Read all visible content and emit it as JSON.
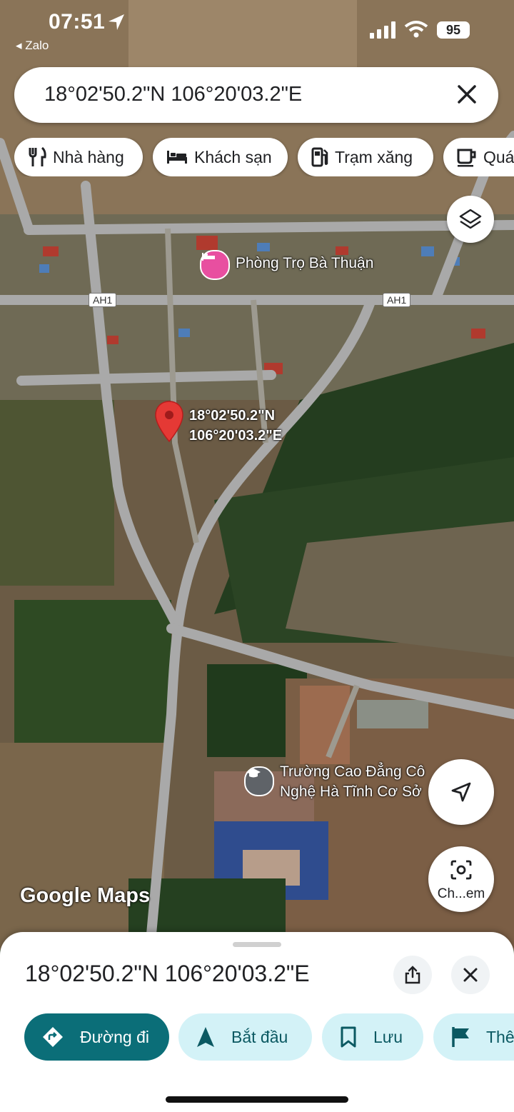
{
  "status_bar": {
    "time": "07:51",
    "back_app": "◂ Zalo",
    "battery": "95"
  },
  "search": {
    "query": "18°02'50.2\"N 106°20'03.2\"E"
  },
  "chips": [
    {
      "label": "Nhà hàng",
      "icon": "fork-knife-icon"
    },
    {
      "label": "Khách sạn",
      "icon": "bed-icon"
    },
    {
      "label": "Trạm xăng",
      "icon": "gas-pump-icon"
    },
    {
      "label": "Quá",
      "icon": "coffee-cup-icon"
    }
  ],
  "map": {
    "places": [
      {
        "name": "Phòng Trọ Bà Thuận",
        "icon": "hotel-bed-icon",
        "color": "#e84fa0"
      },
      {
        "name": "Trường Cao Đẳng Công Nghệ Hà Tĩnh Cơ Sở",
        "line1": "Trường Cao Đẳng Cô",
        "line2": "Nghệ Hà Tĩnh Cơ Sở",
        "icon": "graduation-cap-icon",
        "color": "#5f6368"
      }
    ],
    "road_shields": [
      "AH1",
      "AH1"
    ],
    "pin": {
      "line1": "18°02'50.2\"N",
      "line2": "106°20'03.2\"E",
      "color": "#e53935"
    },
    "logo": "Google Maps",
    "camera_label": "Ch...em"
  },
  "sheet": {
    "title": "18°02'50.2\"N 106°20'03.2\"E",
    "actions": [
      {
        "label": "Đường đi",
        "icon": "directions-icon",
        "style": "primary"
      },
      {
        "label": "Bắt đầu",
        "icon": "navigation-arrow-icon",
        "style": "secondary"
      },
      {
        "label": "Lưu",
        "icon": "bookmark-icon",
        "style": "secondary"
      },
      {
        "label": "Thê",
        "icon": "flag-icon",
        "style": "secondary"
      }
    ]
  },
  "colors": {
    "accent": "#0b6e78",
    "accent_light": "#d3f2f7",
    "pin": "#e53935",
    "hotel": "#e84fa0"
  }
}
